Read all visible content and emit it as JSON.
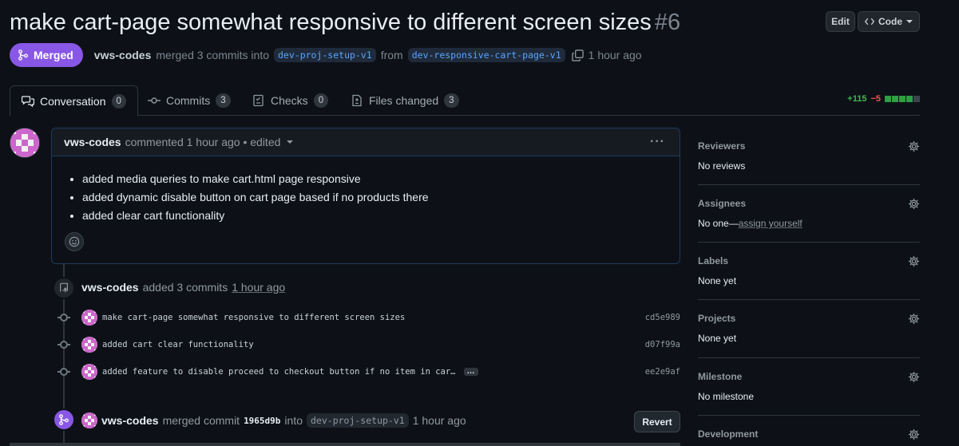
{
  "pr": {
    "title": "make cart-page somewhat responsive to different screen sizes",
    "number": "#6",
    "status": "Merged",
    "author": "vws-codes",
    "action_text": "merged 3 commits into",
    "base_branch": "dev-proj-setup-v1",
    "from_text": "from",
    "head_branch": "dev-responsive-cart-page-v1",
    "time": "1 hour ago"
  },
  "header_buttons": {
    "edit": "Edit",
    "code": "Code"
  },
  "tabs": [
    {
      "label": "Conversation",
      "count": "0",
      "icon": "comment-discussion-icon"
    },
    {
      "label": "Commits",
      "count": "3",
      "icon": "git-commit-icon"
    },
    {
      "label": "Checks",
      "count": "0",
      "icon": "checklist-icon"
    },
    {
      "label": "Files changed",
      "count": "3",
      "icon": "file-diff-icon"
    }
  ],
  "diffstat": {
    "additions": "+115",
    "deletions": "−5",
    "blocks": [
      "green",
      "green",
      "green",
      "green",
      "gray"
    ]
  },
  "comment": {
    "author": "vws-codes",
    "meta": "commented 1 hour ago • edited",
    "items": [
      "added media queries to make cart.html page responsive",
      "added dynamic disable button on cart page based if no products there",
      "added clear cart functionality"
    ]
  },
  "timeline": {
    "push": {
      "author": "vws-codes",
      "text": "added 3 commits",
      "time": "1 hour ago"
    },
    "commits": [
      {
        "message": "make cart-page somewhat responsive to different screen sizes",
        "sha": "cd5e989"
      },
      {
        "message": "added cart clear functionality",
        "sha": "d07f99a"
      },
      {
        "message": "added feature to disable proceed to checkout button if no item in car…",
        "sha": "ee2e9af",
        "ellipsis": "…"
      }
    ],
    "merge": {
      "author": "vws-codes",
      "text": "merged commit",
      "sha": "1965d9b",
      "into": "into",
      "branch": "dev-proj-setup-v1",
      "time": "1 hour ago",
      "revert": "Revert"
    }
  },
  "sidebar": [
    {
      "heading": "Reviewers",
      "value": "No reviews"
    },
    {
      "heading": "Assignees",
      "value": "No one—",
      "link": "assign yourself"
    },
    {
      "heading": "Labels",
      "value": "None yet"
    },
    {
      "heading": "Projects",
      "value": "None yet"
    },
    {
      "heading": "Milestone",
      "value": "No milestone"
    },
    {
      "heading": "Development",
      "value": ""
    }
  ],
  "colors": {
    "merged": "#8957e5",
    "accent_link": "#58a6ff",
    "add": "#3fb950",
    "del": "#f85149",
    "avatar": "#cc66cc"
  }
}
